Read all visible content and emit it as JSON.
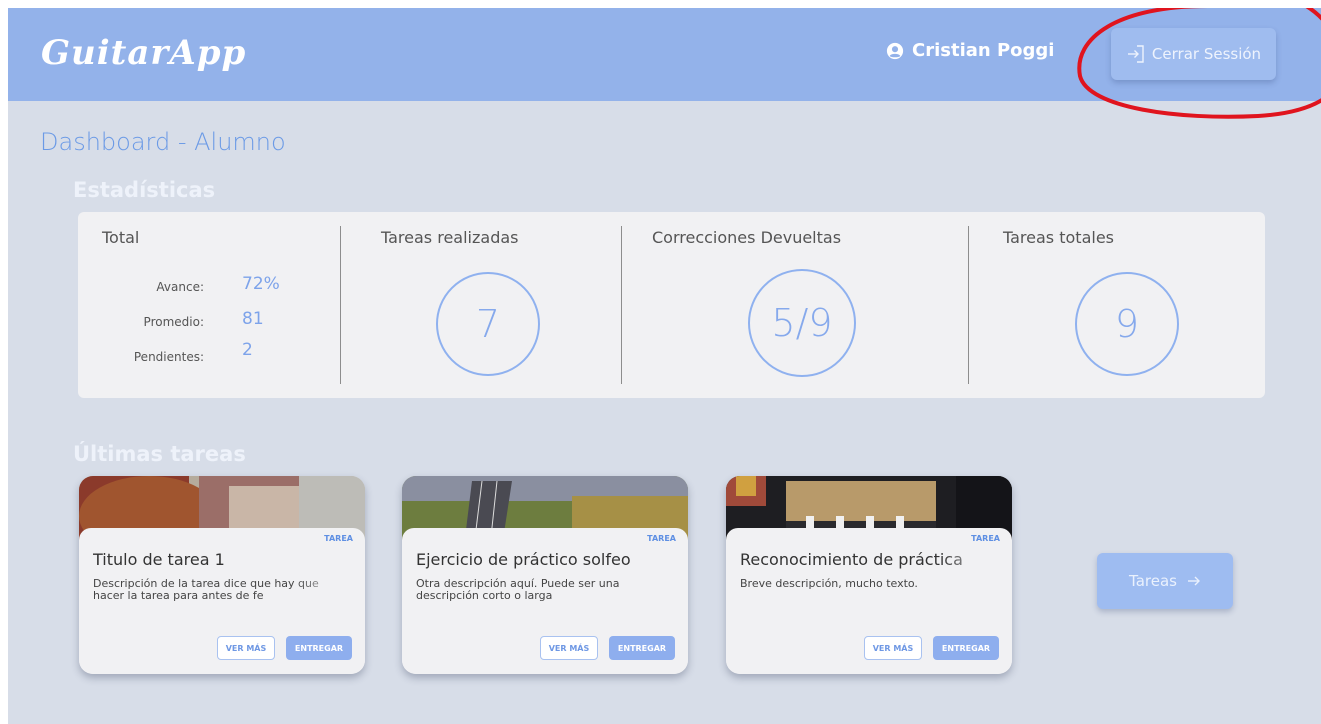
{
  "header": {
    "brand": "GuitarApp",
    "user_name": "Cristian Poggi",
    "logout_label": "Cerrar Sessión"
  },
  "page": {
    "title": "Dashboard - Alumno"
  },
  "stats": {
    "section_title": "Estadísticas",
    "total": {
      "title": "Total",
      "rows": [
        {
          "label": "Avance:",
          "value": "72%"
        },
        {
          "label": "Promedio:",
          "value": "81"
        },
        {
          "label": "Pendientes:",
          "value": "2"
        }
      ]
    },
    "completed": {
      "title": "Tareas realizadas",
      "value": "7"
    },
    "corrections": {
      "title": "Correcciones Devueltas",
      "value": "5/9"
    },
    "total_tasks": {
      "title": "Tareas totales",
      "value": "9"
    }
  },
  "tasks": {
    "section_title": "Últimas tareas",
    "items": [
      {
        "tag": "TAREA",
        "title": "Titulo de tarea 1",
        "description": "Descripción de la tarea dice que hay que hacer la tarea para antes de fe",
        "view_label": "VER MÁS",
        "submit_label": "ENTREGAR"
      },
      {
        "tag": "TAREA",
        "title": "Ejercicio de práctico solfeo",
        "description": "Otra descripción aquí. Puede ser una descripción corto o larga",
        "view_label": "VER MÁS",
        "submit_label": "ENTREGAR"
      },
      {
        "tag": "TAREA",
        "title": "Reconocimiento de práctica",
        "description": "Breve descripción, mucho texto.",
        "view_label": "VER MÁS",
        "submit_label": "ENTREGAR"
      }
    ],
    "more_button": "Tareas"
  },
  "colors": {
    "header": "#93b2ea",
    "background": "#d7dde8",
    "accent": "#6b9ae6",
    "annotation": "#e0141e"
  }
}
